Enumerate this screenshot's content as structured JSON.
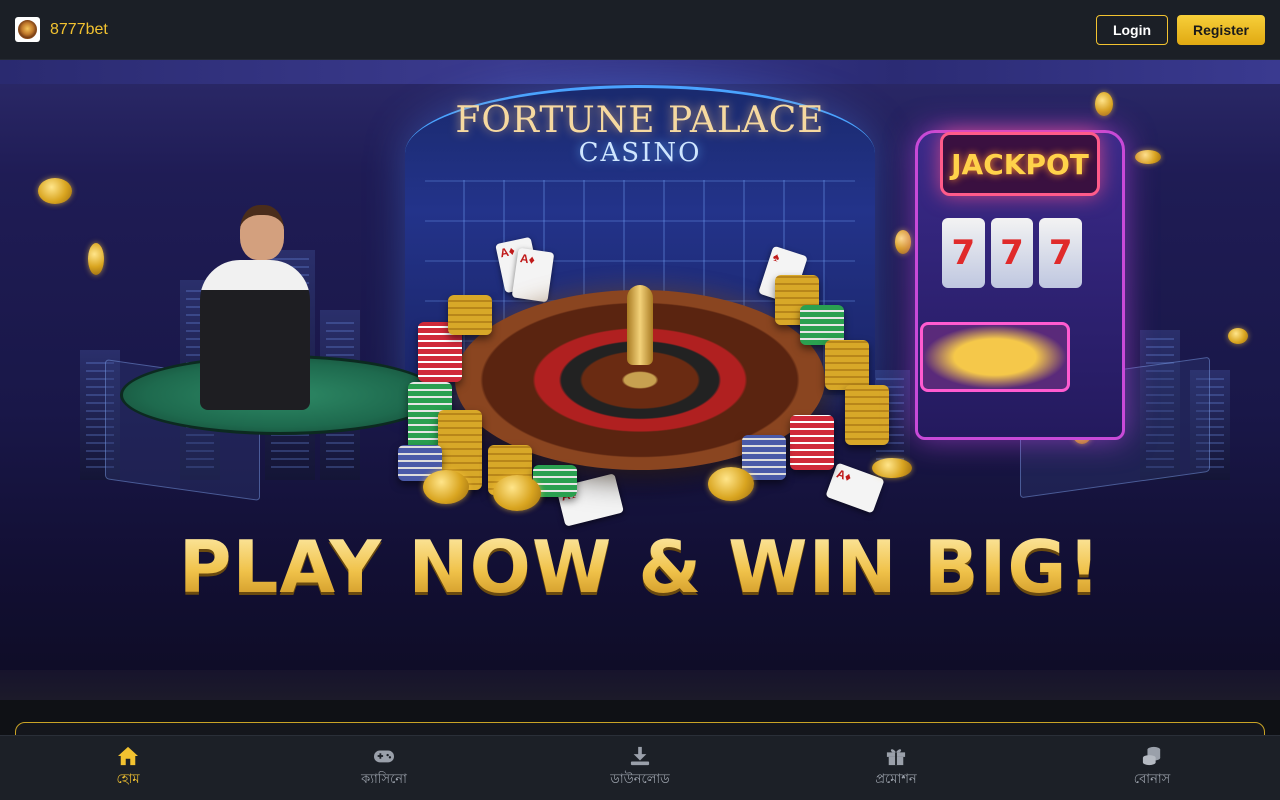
{
  "header": {
    "brand_name": "8777bet",
    "login_label": "Login",
    "register_label": "Register"
  },
  "banner": {
    "palace_title": "FORTUNE PALACE",
    "palace_subtitle": "CASINO",
    "jackpot_label": "JACKPOT",
    "reel_symbol": "7",
    "headline": "PLAY NOW & WIN BIG!"
  },
  "bottom_nav": {
    "items": [
      {
        "label": "হোম",
        "icon": "home-icon",
        "active": true
      },
      {
        "label": "ক্যাসিনো",
        "icon": "gamepad-icon",
        "active": false
      },
      {
        "label": "ডাউনলোড",
        "icon": "download-icon",
        "active": false
      },
      {
        "label": "প্রমোশন",
        "icon": "gift-icon",
        "active": false
      },
      {
        "label": "বোনাস",
        "icon": "coins-icon",
        "active": false
      }
    ]
  },
  "colors": {
    "accent": "#f2c230",
    "header_bg": "#1b1f26",
    "nav_inactive": "#9aa0aa"
  }
}
